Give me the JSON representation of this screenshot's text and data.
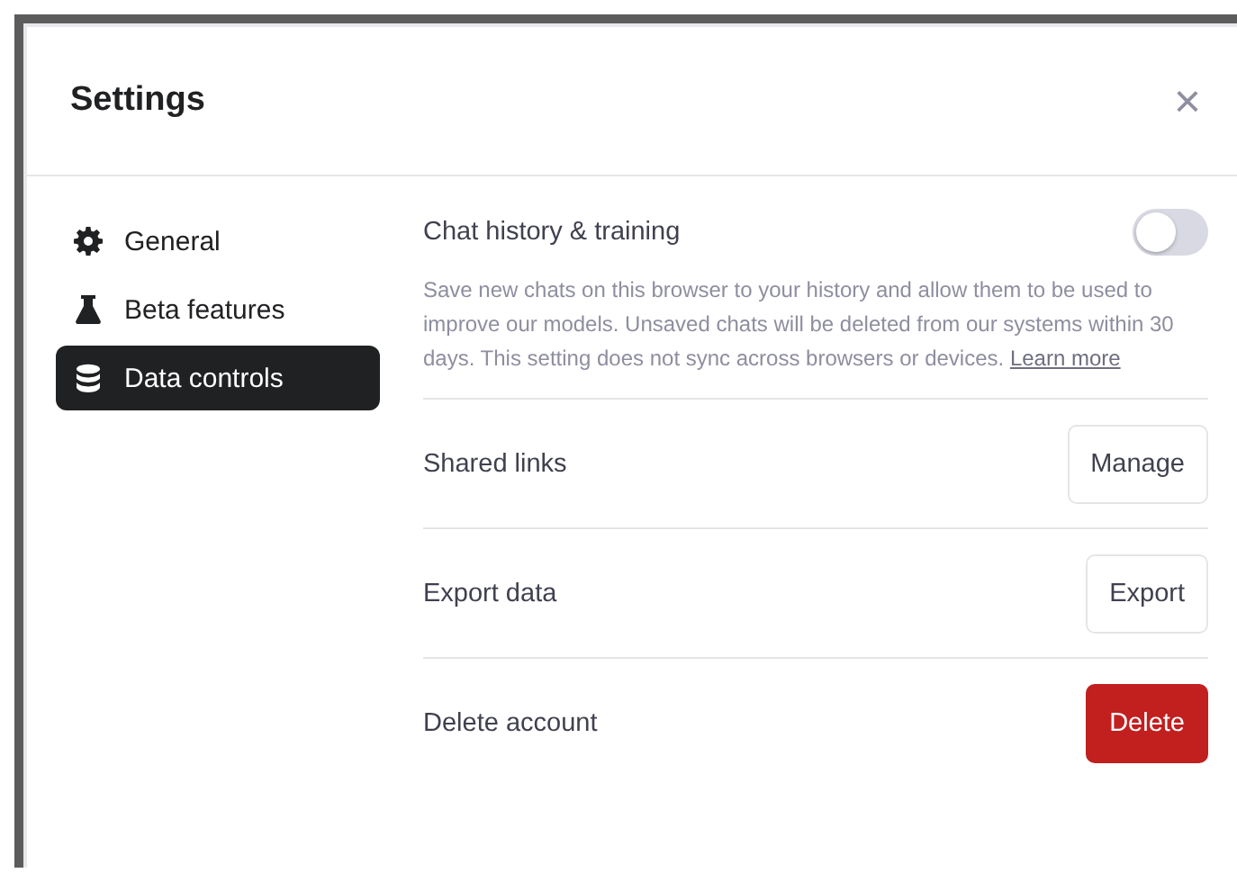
{
  "dialog": {
    "title": "Settings",
    "close": "×"
  },
  "sidebar": {
    "items": [
      {
        "label": "General",
        "selected": false
      },
      {
        "label": "Beta features",
        "selected": false
      },
      {
        "label": "Data controls",
        "selected": true
      }
    ]
  },
  "settings": [
    {
      "kind": "toggle",
      "label": "Chat history & training",
      "on": false,
      "description": "Save new chats on this browser to your history and allow them to be used to improve our models. Unsaved chats will be deleted from our systems within 30 days. This setting does not sync across browsers or devices.",
      "link": "Learn more"
    },
    {
      "kind": "button",
      "label": "Shared links",
      "button": "Manage",
      "danger": false
    },
    {
      "kind": "button",
      "label": "Export data",
      "button": "Export",
      "danger": false
    },
    {
      "kind": "button",
      "label": "Delete account",
      "button": "Delete",
      "danger": true
    }
  ]
}
